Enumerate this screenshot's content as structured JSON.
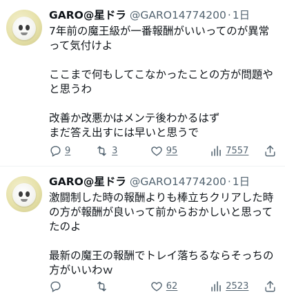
{
  "tweets": [
    {
      "author_name": "GARO@",
      "author_suffix": "星ドラ",
      "handle": "@GARO14774200",
      "separator": "·",
      "time": "1日",
      "lines": [
        "7年前の魔王級が一番報酬がいいってのが異常",
        "って気付けよ",
        "",
        "ここまで何もしてこなかったことの方が問題や",
        "と思うわ",
        "",
        "改善か改悪かはメンテ後わかるはず",
        "まだ答え出すには早いと思うで"
      ],
      "replies": "9",
      "retweets": "3",
      "likes": "95",
      "views": "7557"
    },
    {
      "author_name": "GARO@",
      "author_suffix": "星ドラ",
      "handle": "@GARO14774200",
      "separator": "·",
      "time": "1日",
      "lines": [
        "激闘制した時の報酬よりも棒立ちクリアした時",
        "の方が報酬が良いって前からおかしいと思って",
        "たのよ",
        "",
        "最新の魔王の報酬でトレイ落ちるならそっちの",
        "方がいいわｗ"
      ],
      "replies": "",
      "retweets": "",
      "likes": "62",
      "views": "2523"
    }
  ],
  "colors": {
    "text": "#0f1419",
    "secondary": "#536471",
    "divider": "#eff3f4"
  },
  "icons": [
    "reply-icon",
    "retweet-icon",
    "like-icon",
    "views-icon",
    "share-icon"
  ]
}
